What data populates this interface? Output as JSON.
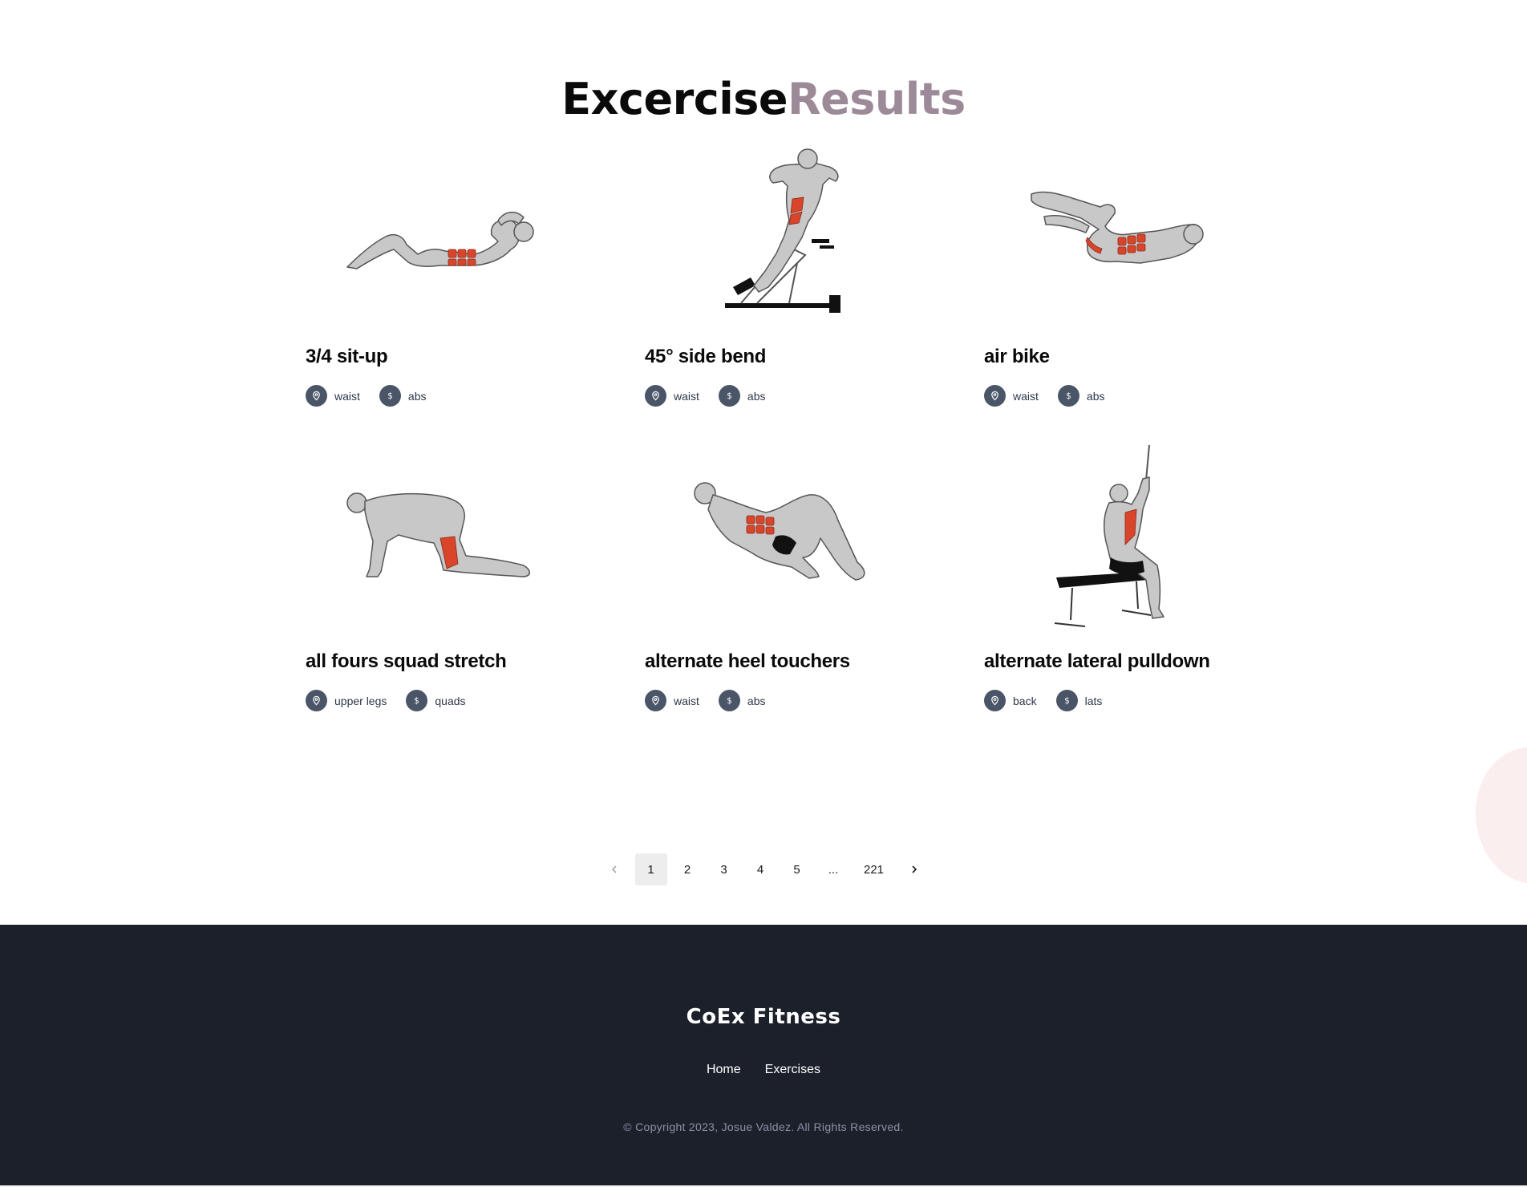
{
  "title": {
    "part1": "Excercise",
    "part2": "Results"
  },
  "exercises": [
    {
      "name": "3/4 sit-up",
      "body_part": "waist",
      "target": "abs",
      "illustration": "sit-up-figure"
    },
    {
      "name": "45° side bend",
      "body_part": "waist",
      "target": "abs",
      "illustration": "side-bend-bench-figure"
    },
    {
      "name": "air bike",
      "body_part": "waist",
      "target": "abs",
      "illustration": "air-bike-figure"
    },
    {
      "name": "all fours squad stretch",
      "body_part": "upper legs",
      "target": "quads",
      "illustration": "all-fours-figure"
    },
    {
      "name": "alternate heel touchers",
      "body_part": "waist",
      "target": "abs",
      "illustration": "heel-touch-figure"
    },
    {
      "name": "alternate lateral pulldown",
      "body_part": "back",
      "target": "lats",
      "illustration": "pulldown-figure"
    }
  ],
  "tag_icons": {
    "body_part": "location-pin-icon",
    "target": "dollar-icon"
  },
  "pagination": {
    "prev": "‹",
    "pages": [
      "1",
      "2",
      "3",
      "4",
      "5",
      "...",
      "221"
    ],
    "current": "1",
    "next": "›"
  },
  "footer": {
    "brand": "CoEx Fitness",
    "links": [
      "Home",
      "Exercises"
    ],
    "copyright": "© Copyright 2023, Josue Valdez. All Rights Reserved."
  },
  "colors": {
    "title_primary": "#0a0a0a",
    "title_accent": "#9c8a98",
    "tag_icon_bg": "#4a5568",
    "muscle_highlight": "#d9452b",
    "footer_bg": "#1c202b"
  }
}
